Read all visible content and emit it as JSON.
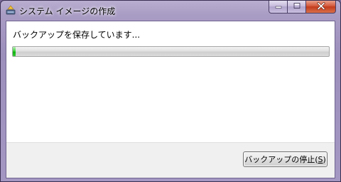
{
  "window": {
    "title": "システム イメージの作成",
    "icon": "backup-app-icon"
  },
  "caption": {
    "minimize_icon": "minimize-icon",
    "maximize_icon": "maximize-icon",
    "close_icon": "close-icon"
  },
  "content": {
    "status_text": "バックアップを保存しています...",
    "progress_fraction": 0.01,
    "progress_color": "#1cbf1c"
  },
  "footer": {
    "stop_button": {
      "label_prefix": "バックアップの停止(",
      "mnemonic": "S",
      "label_suffix": ")"
    }
  }
}
